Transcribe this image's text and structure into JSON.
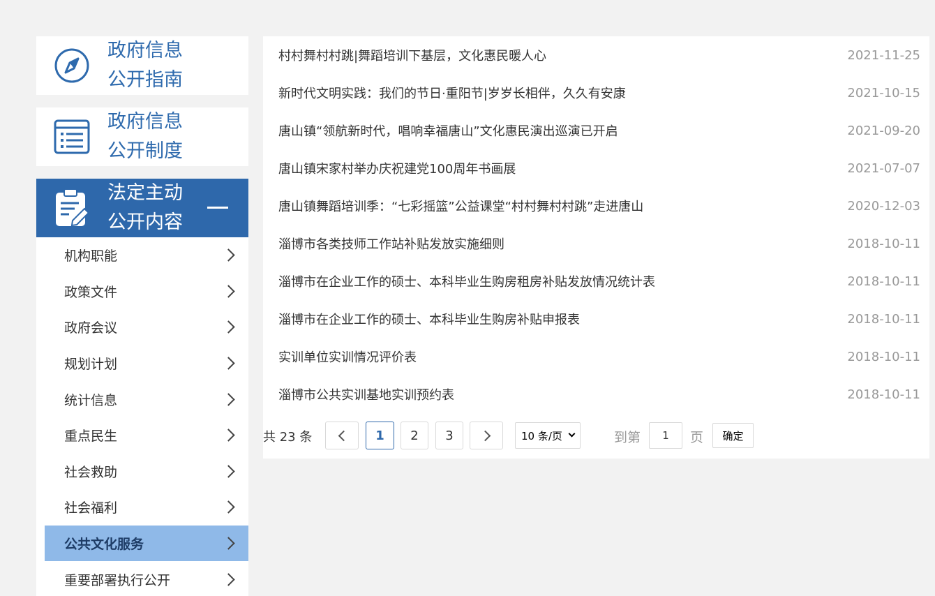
{
  "sidebar": {
    "categories": [
      {
        "line1": "政府信息",
        "line2": "公开指南",
        "icon": "compass-icon"
      },
      {
        "line1": "政府信息",
        "line2": "公开制度",
        "icon": "list-icon"
      },
      {
        "line1": "法定主动",
        "line2": "公开内容",
        "icon": "clipboard-edit-icon"
      }
    ],
    "items": [
      {
        "label": "机构职能"
      },
      {
        "label": "政策文件"
      },
      {
        "label": "政府会议"
      },
      {
        "label": "规划计划"
      },
      {
        "label": "统计信息"
      },
      {
        "label": "重点民生"
      },
      {
        "label": "社会救助"
      },
      {
        "label": "社会福利"
      },
      {
        "label": "公共文化服务",
        "active": true
      },
      {
        "label": "重要部署执行公开"
      }
    ]
  },
  "articles": [
    {
      "title": "村村舞村村跳|舞蹈培训下基层，文化惠民暖人心",
      "date": "2021-11-25"
    },
    {
      "title": "新时代文明实践：我们的节日·重阳节|岁岁长相伴，久久有安康",
      "date": "2021-10-15"
    },
    {
      "title": "唐山镇“领航新时代，唱响幸福唐山”文化惠民演出巡演已开启",
      "date": "2021-09-20"
    },
    {
      "title": "唐山镇宋家村举办庆祝建党100周年书画展",
      "date": "2021-07-07"
    },
    {
      "title": "唐山镇舞蹈培训季：“七彩摇篮”公益课堂“村村舞村村跳”走进唐山",
      "date": "2020-12-03"
    },
    {
      "title": "淄博市各类技师工作站补贴发放实施细则",
      "date": "2018-10-11"
    },
    {
      "title": "淄博市在企业工作的硕士、本科毕业生购房租房补贴发放情况统计表",
      "date": "2018-10-11"
    },
    {
      "title": "淄博市在企业工作的硕士、本科毕业生购房补贴申报表",
      "date": "2018-10-11"
    },
    {
      "title": "实训单位实训情况评价表",
      "date": "2018-10-11"
    },
    {
      "title": "淄博市公共实训基地实训预约表",
      "date": "2018-10-11"
    }
  ],
  "pagination": {
    "total_label": "共 23 条",
    "pages": [
      "1",
      "2",
      "3"
    ],
    "current_page": "1",
    "page_size": "10 条/页",
    "goto_prefix": "到第",
    "goto_value": "1",
    "goto_suffix": "页",
    "confirm_label": "确定"
  },
  "colors": {
    "accent": "#2e68ab",
    "active_item_bg": "#8fb9e8",
    "page_bg": "#f2f2f2"
  }
}
